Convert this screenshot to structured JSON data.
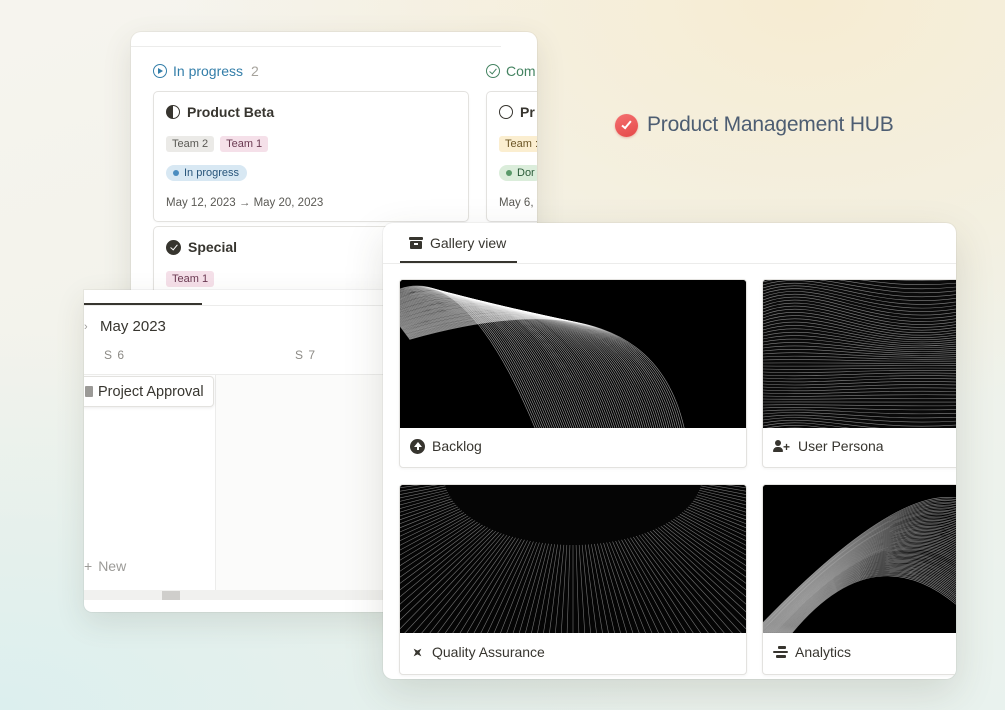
{
  "brand": {
    "title": "Product Management HUB",
    "icon": "check-badge-icon",
    "accent": "#e95656"
  },
  "board": {
    "columns": [
      {
        "label": "In progress",
        "count": "2",
        "color": "#337ea9"
      },
      {
        "label": "Com",
        "color": "#448361"
      }
    ],
    "cards": [
      {
        "title": "Product Beta",
        "tags": [
          "Team 2",
          "Team 1"
        ],
        "status": "In progress",
        "dates": "May 12, 2023 → May 20, 2023"
      },
      {
        "title": "Pr",
        "tags": [
          "Team :"
        ],
        "status": "Dor",
        "dates": "May 6, :"
      },
      {
        "title": "Special",
        "tags": [
          "Team 1"
        ]
      }
    ]
  },
  "timeline": {
    "month": "May 2023",
    "days": [
      "S 6",
      "S 7"
    ],
    "item": "Project Approval",
    "new_label": "New"
  },
  "gallery": {
    "tab_label": "Gallery view",
    "cards": [
      {
        "label": "Backlog",
        "icon": "arrow-up-circle-icon"
      },
      {
        "label": "User Persona",
        "icon": "user-add-icon"
      },
      {
        "label": "Quality Assurance",
        "icon": "sparkle-diamond-icon"
      },
      {
        "label": "Analytics",
        "icon": "timeline-bars-icon"
      }
    ]
  }
}
